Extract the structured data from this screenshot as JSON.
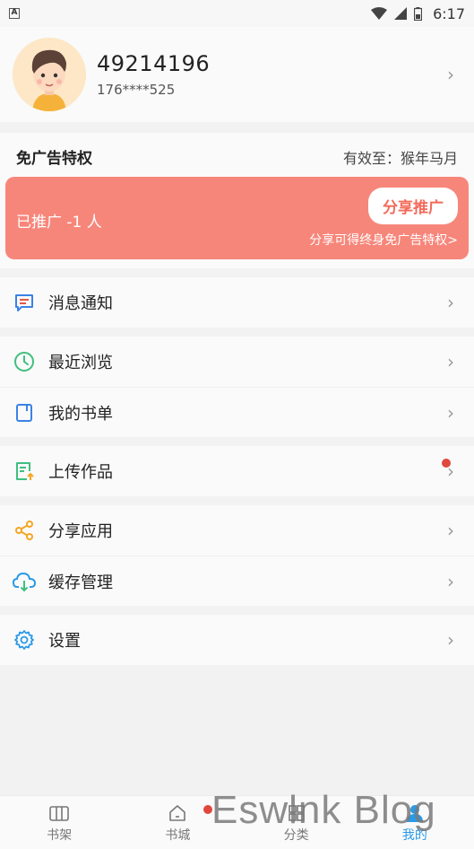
{
  "status": {
    "time": "6:17",
    "a_label": "A"
  },
  "profile": {
    "user_id": "49214196",
    "phone": "176****525"
  },
  "vip": {
    "title": "免广告特权",
    "valid": "有效至：猴年马月",
    "count": "已推广 -1 人",
    "share_button": "分享推广",
    "hint": "分享可得终身免广告特权>"
  },
  "menu": [
    {
      "label": "消息通知",
      "icon": "message-icon"
    },
    {
      "label": "最近浏览",
      "icon": "clock-icon"
    },
    {
      "label": "我的书单",
      "icon": "book-icon"
    },
    {
      "label": "上传作品",
      "icon": "upload-icon"
    },
    {
      "label": "分享应用",
      "icon": "share-icon"
    },
    {
      "label": "缓存管理",
      "icon": "cloud-download-icon"
    },
    {
      "label": "设置",
      "icon": "gear-icon"
    }
  ],
  "tabs": [
    {
      "label": "书架"
    },
    {
      "label": "书城"
    },
    {
      "label": "分类"
    },
    {
      "label": "我的"
    }
  ],
  "watermark": "Eswlnk Blog",
  "colors": {
    "accent": "#2a9ae8",
    "banner": "#f7867a",
    "badge": "#e0483d"
  }
}
